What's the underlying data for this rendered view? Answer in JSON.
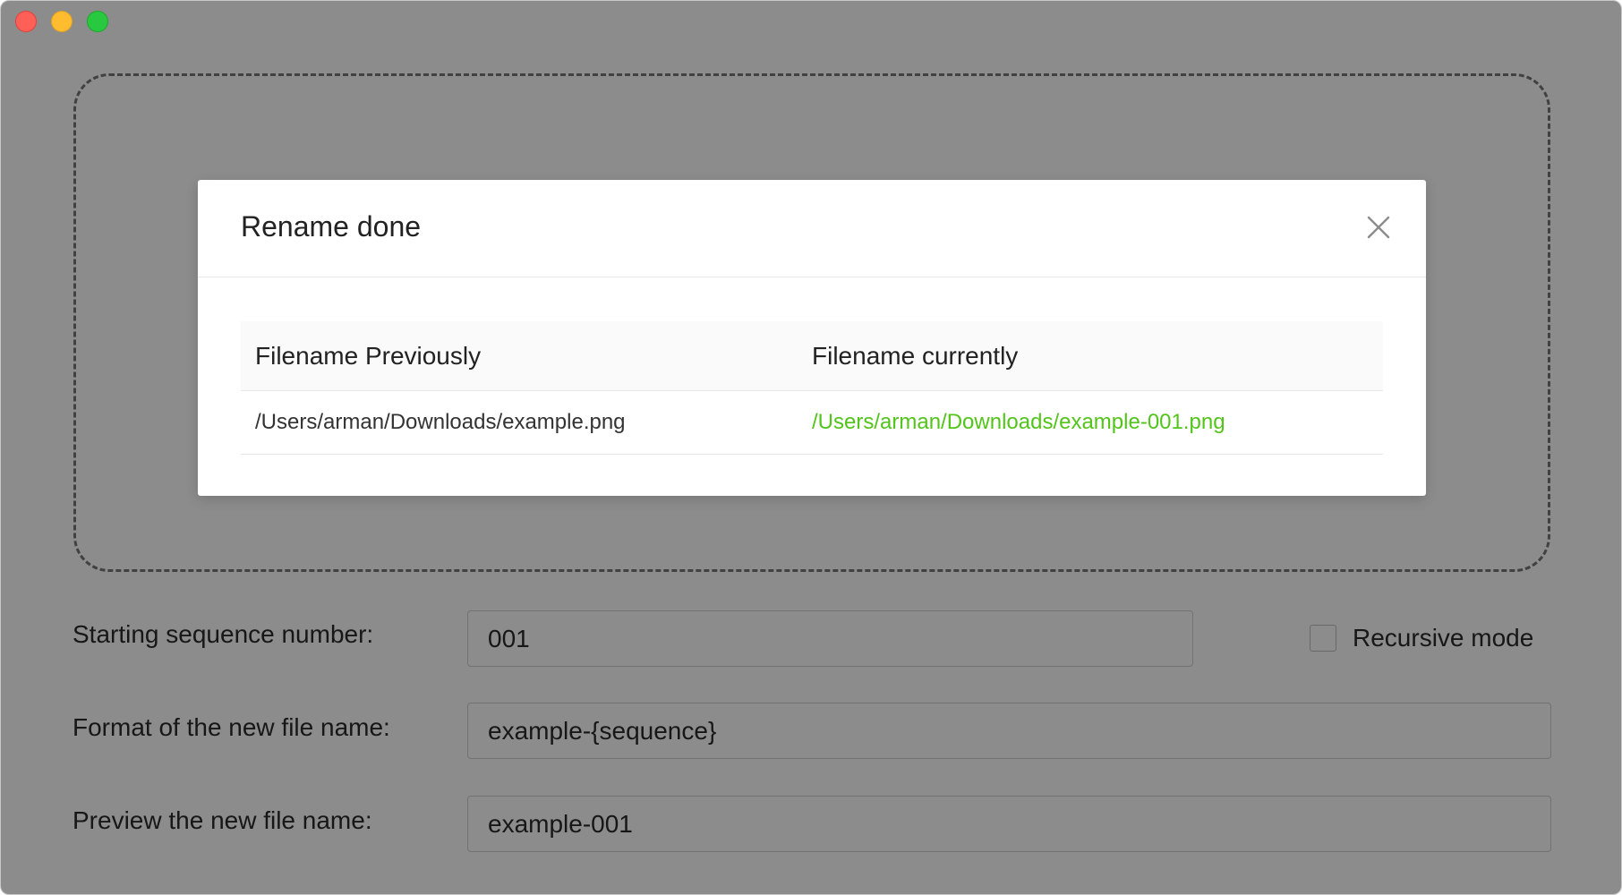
{
  "window": {
    "traffic_lights": [
      "close",
      "minimize",
      "zoom"
    ]
  },
  "form": {
    "start_label": "Starting sequence number:",
    "start_value": "001",
    "format_label": "Format of the new file name:",
    "format_value": "example-{sequence}",
    "preview_label": "Preview the new file name:",
    "preview_value": "example-001",
    "recursive_label": "Recursive mode",
    "recursive_checked": false
  },
  "modal": {
    "title": "Rename done",
    "close_icon": "close-icon",
    "table": {
      "headers": [
        "Filename Previously",
        "Filename currently"
      ],
      "rows": [
        [
          "/Users/arman/Downloads/example.png",
          "/Users/arman/Downloads/example-001.png"
        ]
      ]
    }
  },
  "colors": {
    "success": "#52c41a",
    "overlay": "rgba(0,0,0,0.45)"
  }
}
